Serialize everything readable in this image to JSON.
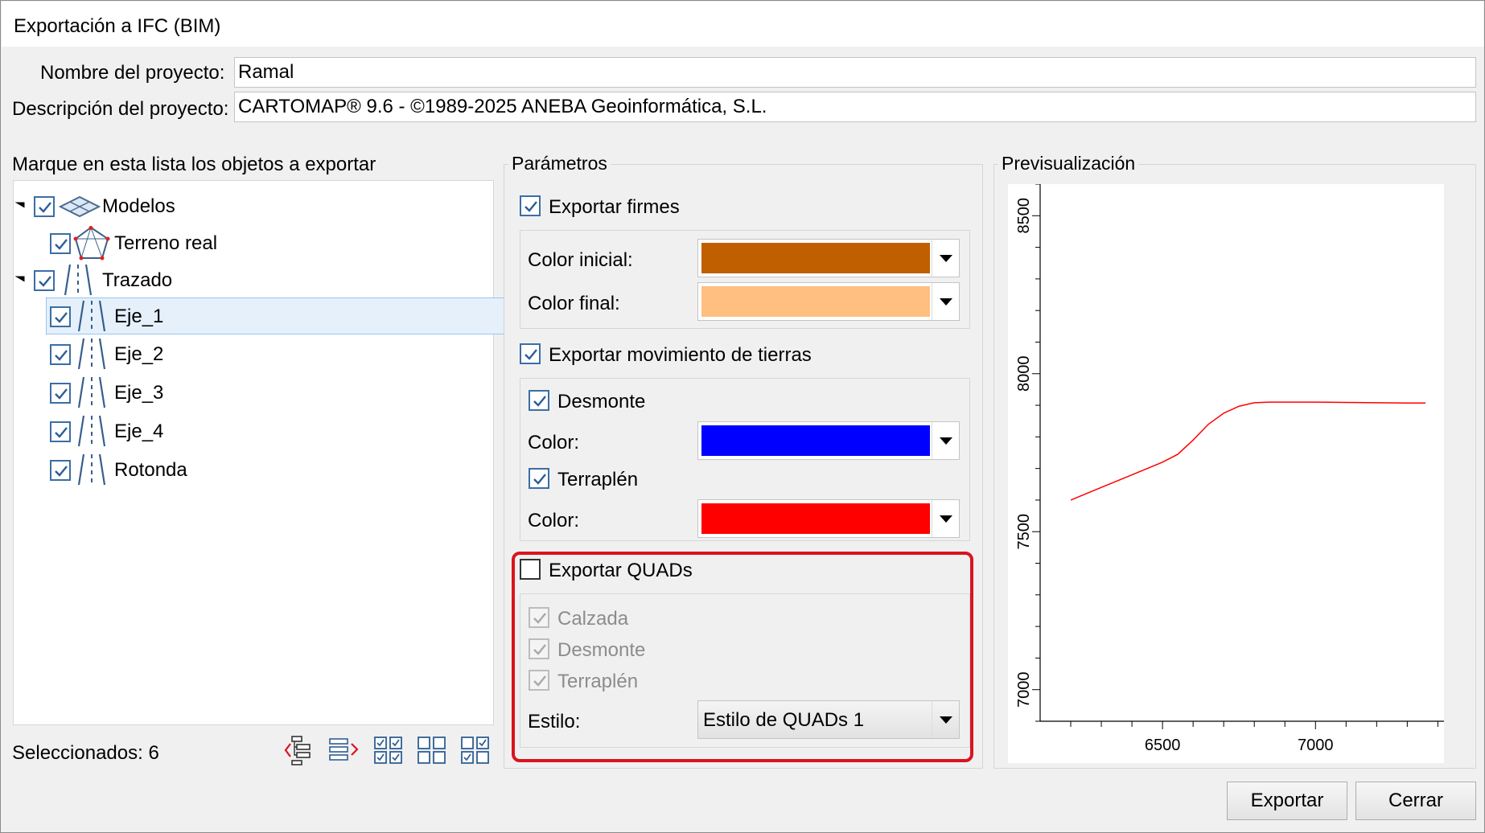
{
  "window": {
    "title": "Exportación a IFC (BIM)"
  },
  "project": {
    "name_label": "Nombre del proyecto:",
    "name_value": "Ramal",
    "desc_label": "Descripción del proyecto:",
    "desc_value": "CARTOMAP® 9.6 - ©1989-2025 ANEBA Geoinformática, S.L."
  },
  "objects": {
    "header": "Marque en esta lista los objetos a exportar",
    "tree": [
      {
        "label": "Modelos",
        "checked": true,
        "icon": "models-icon",
        "level": 0,
        "expanded": true
      },
      {
        "label": "Terreno real",
        "checked": true,
        "icon": "terrain-icon",
        "level": 1
      },
      {
        "label": "Trazado",
        "checked": true,
        "icon": "road-icon",
        "level": 0,
        "expanded": true
      },
      {
        "label": "Eje_1",
        "checked": true,
        "icon": "road-icon",
        "level": 1,
        "selected": true
      },
      {
        "label": "Eje_2",
        "checked": true,
        "icon": "road-icon",
        "level": 1
      },
      {
        "label": "Eje_3",
        "checked": true,
        "icon": "road-icon",
        "level": 1
      },
      {
        "label": "Eje_4",
        "checked": true,
        "icon": "road-icon",
        "level": 1
      },
      {
        "label": "Rotonda",
        "checked": true,
        "icon": "road-icon",
        "level": 1
      }
    ],
    "selected_count": "Seleccionados: 6",
    "tools": [
      "collapse-tree-icon",
      "expand-tree-icon",
      "check-all-icon",
      "uncheck-all-icon",
      "invert-check-icon"
    ]
  },
  "params": {
    "header": "Parámetros",
    "firmes": {
      "label": "Exportar firmes",
      "checked": true,
      "color_inicial_label": "Color inicial:",
      "color_inicial": "#c05f00",
      "color_final_label": "Color final:",
      "color_final": "#ffbf80"
    },
    "tierras": {
      "label": "Exportar movimiento de tierras",
      "checked": true,
      "desmonte_label": "Desmonte",
      "desmonte_checked": true,
      "desmonte_color_label": "Color:",
      "desmonte_color": "#0000ff",
      "terraplen_label": "Terraplén",
      "terraplen_checked": true,
      "terraplen_color_label": "Color:",
      "terraplen_color": "#ff0000"
    },
    "quads": {
      "label": "Exportar QUADs",
      "checked": false,
      "calzada": "Calzada",
      "desmonte": "Desmonte",
      "terraplen": "Terraplén",
      "estilo_label": "Estilo:",
      "estilo_value": "Estilo de QUADs 1"
    }
  },
  "preview": {
    "header": "Previsualización",
    "chart_data": {
      "type": "line",
      "series": [
        {
          "color": "#ff0000",
          "x": [
            6200,
            6300,
            6400,
            6500,
            6550,
            6600,
            6650,
            6700,
            6750,
            6800,
            6850,
            6900,
            7000,
            7100,
            7200,
            7300,
            7360
          ],
          "y": [
            7600,
            7640,
            7680,
            7720,
            7745,
            7790,
            7840,
            7875,
            7897,
            7908,
            7910,
            7910,
            7910,
            7909,
            7908,
            7907,
            7907
          ]
        }
      ],
      "xticks": [
        "6500",
        "7000"
      ],
      "yticks": [
        "7000",
        "7500",
        "8000",
        "8500"
      ],
      "xlim": [
        6100,
        7420
      ],
      "ylim": [
        6900,
        8600
      ],
      "grid": false
    }
  },
  "buttons": {
    "export": "Exportar",
    "close": "Cerrar"
  },
  "highlight_color": "#d9141e"
}
